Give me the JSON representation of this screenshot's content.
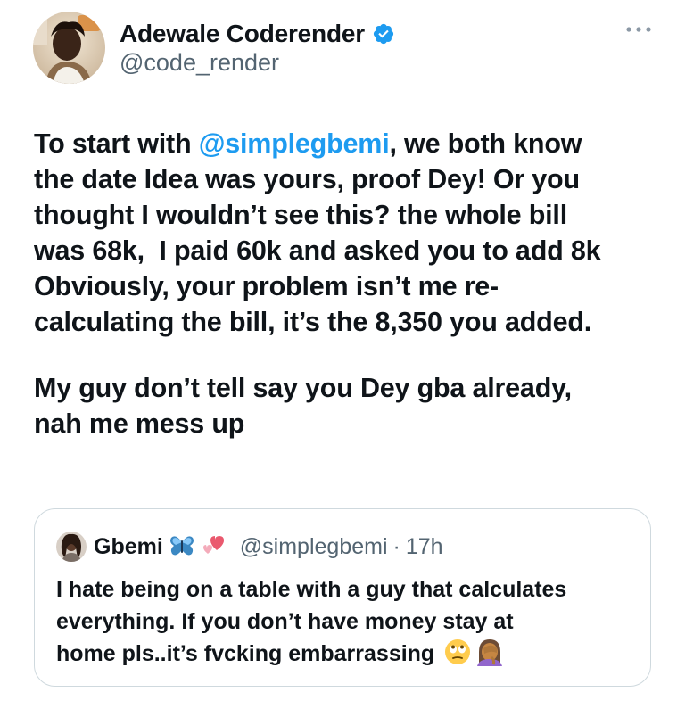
{
  "tweet": {
    "author": {
      "display_name": "Adewale Coderender",
      "handle": "@code_render",
      "verified": true,
      "avatar_icon": "user-avatar-photo"
    },
    "more_icon": "more-dots-icon",
    "body": {
      "paragraph1": {
        "line1_prefix": "To start with ",
        "line1_mention": "@simplegbemi",
        "line1_suffix": ", we both know",
        "line2": "the date Idea was yours, proof Dey! Or you",
        "line3": "thought I wouldn’t see this? the whole bill",
        "line4": "was 68k,  I paid 60k and asked you to add 8k",
        "line5": "Obviously, your problem isn’t me re-",
        "line6": "calculating the bill, it’s the 8,350 you added."
      },
      "paragraph2": {
        "line1": "My guy don’t tell say you Dey gba already,",
        "line2": "nah me mess up"
      }
    },
    "quoted_tweet": {
      "display_name": "Gbemi",
      "name_emojis": [
        "butterfly-emoji",
        "two-hearts-emoji"
      ],
      "handle": "@simplegbemi",
      "separator": "·",
      "timestamp": "17h",
      "text": {
        "line1": "I hate being on a table with a guy that calculates",
        "line2": "everything. If you don’t have money stay at",
        "line3": "home pls..it’s fvcking embarrassing"
      },
      "trailing_emojis": [
        "face-with-rolling-eyes-emoji",
        "woman-facepalming-emoji"
      ]
    }
  },
  "colors": {
    "text_primary": "#0f1419",
    "text_secondary": "#536471",
    "link_blue": "#1d9bf0",
    "verified_blue": "#1d9bf0",
    "card_border": "#cfd9de"
  }
}
